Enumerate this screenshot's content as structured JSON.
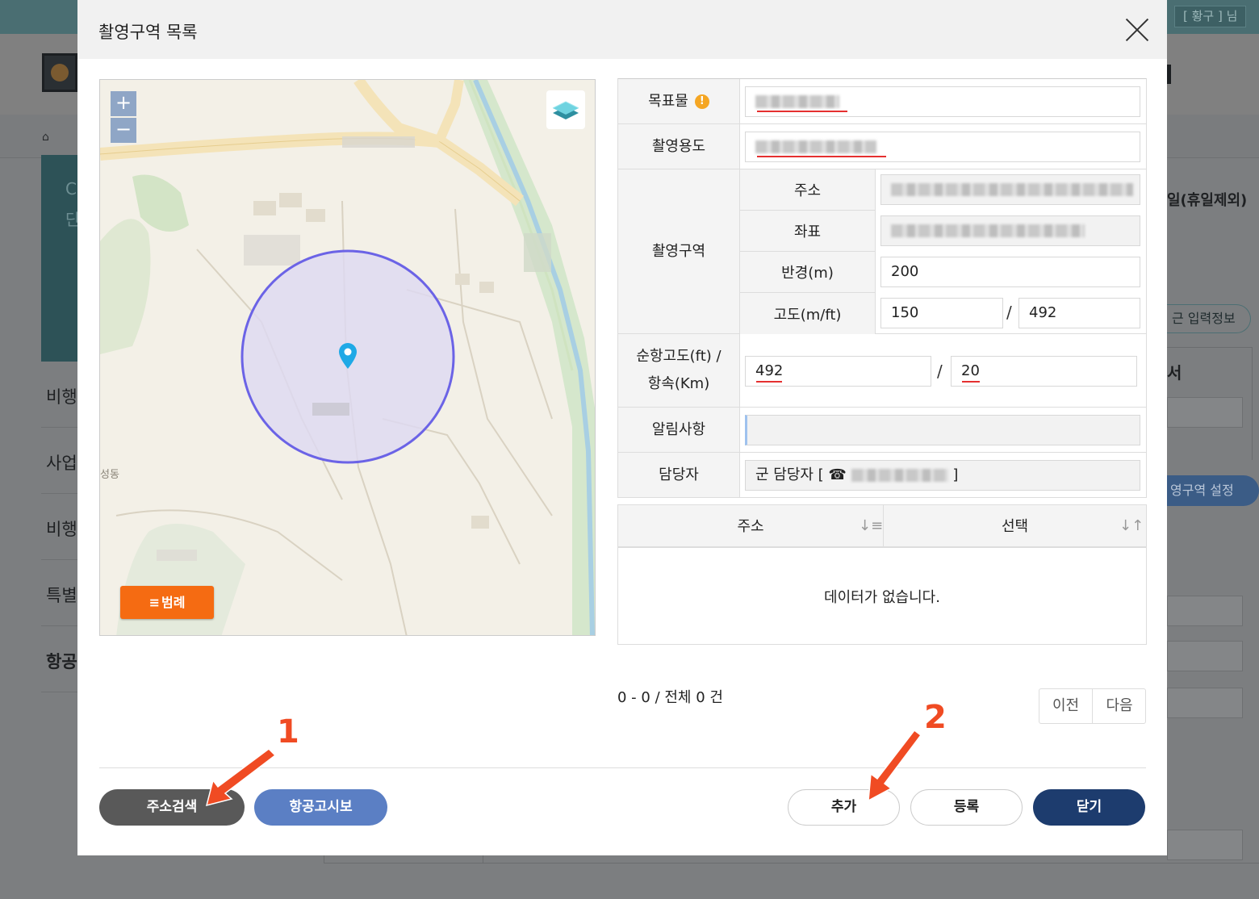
{
  "background": {
    "user_badge": "[ 황구 ] 님",
    "side_menu": [
      "비행",
      "사업",
      "비행",
      "특별",
      "항공"
    ],
    "banner_letters": [
      "C",
      "단"
    ],
    "right_text": "일(휴일제외)",
    "right_button": "근 입력정보",
    "right_mark": "서",
    "right_setting_button": "영구역 설정"
  },
  "modal": {
    "title": "촬영구역 목록",
    "close_icon": "close-icon"
  },
  "map": {
    "zoom_in": "+",
    "zoom_out": "−",
    "layers_icon": "layers-icon",
    "legend_label": "범례",
    "legend_icon": "≡",
    "place_label": "성동",
    "marker_icon": "map-pin-icon",
    "colors": {
      "circle_stroke": "#6b63e6",
      "circle_fill": "#ddd9f3",
      "marker": "#1fa9e6",
      "legend": "#f56b12"
    }
  },
  "form": {
    "target_label": "목표물",
    "target_warning_icon": "!",
    "purpose_label": "촬영용도",
    "area_label": "촬영구역",
    "address_label": "주소",
    "coord_label": "좌표",
    "radius_label": "반경(m)",
    "radius_value": "200",
    "altitude_label": "고도(m/ft)",
    "altitude_m": "150",
    "altitude_ft": "492",
    "cruise_label_1": "순항고도(ft) /",
    "cruise_label_2": "항속(Km)",
    "cruise_alt": "492",
    "cruise_speed": "20",
    "notice_label": "알림사항",
    "notice_value": "",
    "manager_label": "담당자",
    "manager_prefix": "군 담당자  [",
    "manager_phone_icon": "☎",
    "manager_suffix": "]",
    "separator": "/"
  },
  "list": {
    "columns": [
      "주소",
      "선택"
    ],
    "sort_icons": [
      "↓≡",
      "↓↑"
    ],
    "empty_message": "데이터가 없습니다."
  },
  "pager": {
    "info": "0 - 0 / 전체 0 건",
    "prev": "이전",
    "next": "다음"
  },
  "buttons": {
    "search": "주소검색",
    "notam": "항공고시보",
    "add": "추가",
    "register": "등록",
    "close": "닫기"
  },
  "annotations": {
    "step1": "1",
    "step2": "2",
    "color": "#f04b23"
  }
}
